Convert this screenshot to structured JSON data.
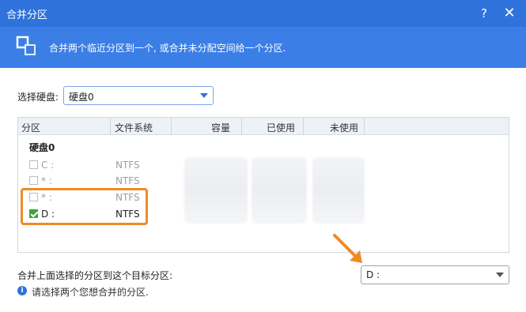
{
  "window": {
    "title": "合并分区",
    "help_label": "?",
    "close_label": "✕"
  },
  "banner": {
    "icon": "merge-partition-icon",
    "text": "合并两个临近分区到一个, 或合并未分配空间给一个分区."
  },
  "disk_select": {
    "label": "选择硬盘:",
    "value": "硬盘0"
  },
  "table": {
    "headers": [
      "分区",
      "文件系统",
      "容量",
      "已使用",
      "未使用"
    ],
    "group": "硬盘0",
    "rows": [
      {
        "name": "C :",
        "fs": "NTFS",
        "checked": false
      },
      {
        "name": "* :",
        "fs": "NTFS",
        "checked": false
      },
      {
        "name": "* :",
        "fs": "NTFS",
        "checked": false
      },
      {
        "name": "D :",
        "fs": "NTFS",
        "checked": true
      }
    ]
  },
  "target": {
    "label": "合并上面选择的分区到这个目标分区:",
    "value": "D :"
  },
  "info": {
    "icon": "info-icon",
    "text": "请选择两个您想合并的分区."
  },
  "colors": {
    "titlebar": "#2f72db",
    "banner": "#3b7fe6",
    "highlight": "#f08a25",
    "check": "#3aa53a"
  }
}
